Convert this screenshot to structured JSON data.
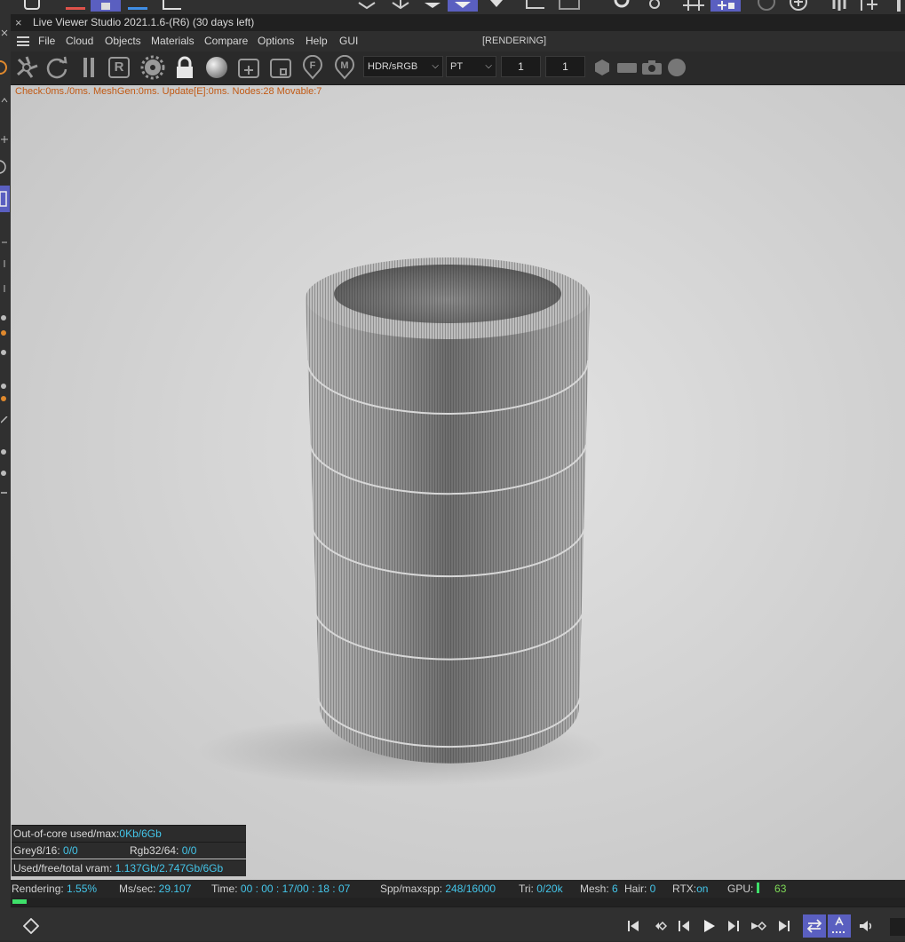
{
  "window": {
    "close_glyph": "×",
    "title": "Live Viewer Studio 2021.1.6-(R6) (30 days left)"
  },
  "menu": {
    "items": [
      "File",
      "Cloud",
      "Objects",
      "Materials",
      "Compare",
      "Options",
      "Help",
      "GUI"
    ],
    "status": "[RENDERING]"
  },
  "toolbar": {
    "render_mode": "HDR/sRGB",
    "kernel": "PT",
    "field_a": "1",
    "field_b": "1",
    "region_letter": "R",
    "f_letter": "F",
    "m_letter": "M"
  },
  "viewport": {
    "stats": "Check:0ms./0ms. MeshGen:0ms. Update[E]:0ms. Nodes:28 Movable:7",
    "memory": {
      "ooc_label": "Out-of-core used/max:",
      "ooc_value": "0Kb/6Gb",
      "grey_label": "Grey8/16: ",
      "grey_value": "0/0",
      "rgb_label": "Rgb32/64: ",
      "rgb_value": "0/0",
      "vram_label": "Used/free/total vram: ",
      "vram_value": "1.137Gb/2.747Gb/6Gb"
    }
  },
  "status": {
    "rendering_label": "Rendering: ",
    "rendering_value": "1.55%",
    "mssec_label": "Ms/sec: ",
    "mssec_value": "29.107",
    "time_label": "Time: ",
    "time_value": "00 : 00 : 17/00 : 18 : 07",
    "spp_label": "Spp/maxspp: ",
    "spp_value": "248/16000",
    "tri_label": "Tri: ",
    "tri_value": "0/20k",
    "mesh_label": "Mesh: ",
    "mesh_value": "6",
    "hair_label": "Hair: ",
    "hair_value": "0",
    "rtx_label": "RTX:",
    "rtx_value": "on",
    "gpu_label": "GPU:",
    "gpu_value": "63",
    "progress": 0.0155
  },
  "colors": {
    "accent_cyan": "#44c6ea",
    "gpu_green": "#7ed957",
    "stats_orange": "#c25a14",
    "progress_green": "#3ee06a",
    "host_blue": "#5a5fc0"
  }
}
